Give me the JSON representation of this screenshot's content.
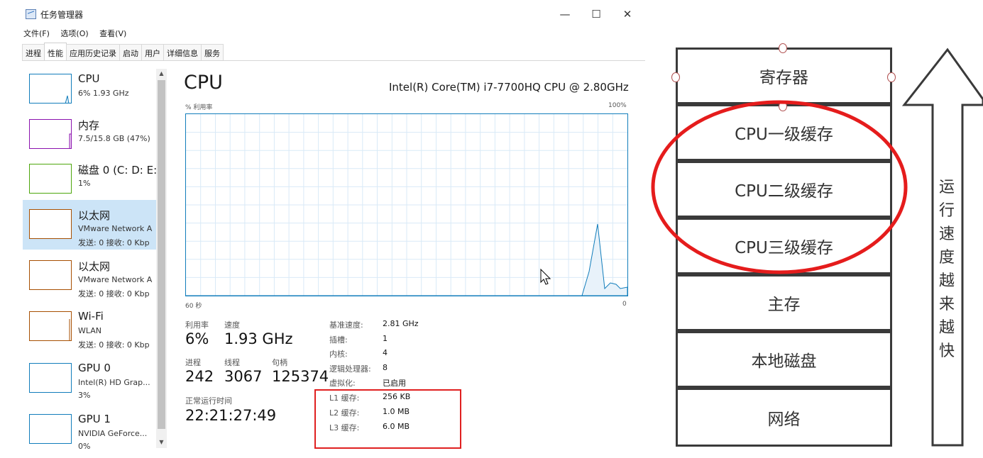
{
  "window": {
    "title": "任务管理器",
    "menu": [
      "文件(F)",
      "选项(O)",
      "查看(V)"
    ],
    "tabs": [
      "进程",
      "性能",
      "应用历史记录",
      "启动",
      "用户",
      "详细信息",
      "服务"
    ],
    "active_tab": "性能"
  },
  "sidebar": {
    "items": [
      {
        "name": "CPU",
        "sub": "6% 1.93 GHz",
        "sub2": "",
        "color": "#117dbb"
      },
      {
        "name": "内存",
        "sub": "7.5/15.8 GB (47%)",
        "sub2": "",
        "color": "#8b12ae"
      },
      {
        "name": "磁盘 0 (C: D: E:",
        "sub": "1%",
        "sub2": "",
        "color": "#4da60c"
      },
      {
        "name": "以太网",
        "sub": "VMware Network A",
        "sub2": "发送: 0 接收: 0 Kbp",
        "color": "#a74f01"
      },
      {
        "name": "以太网",
        "sub": "VMware Network A",
        "sub2": "发送: 0 接收: 0 Kbp",
        "color": "#a74f01"
      },
      {
        "name": "Wi-Fi",
        "sub": "WLAN",
        "sub2": "发送: 0 接收: 0 Kbp",
        "color": "#a74f01"
      },
      {
        "name": "GPU 0",
        "sub": "Intel(R) HD Grap...",
        "sub2": "3%",
        "color": "#117dbb"
      },
      {
        "name": "GPU 1",
        "sub": "NVIDIA GeForce...",
        "sub2": "0%",
        "color": "#117dbb"
      }
    ]
  },
  "main": {
    "title": "CPU",
    "model": "Intel(R) Core(TM) i7-7700HQ CPU @ 2.80GHz",
    "graph_ylabel": "% 利用率",
    "graph_ymax": "100%",
    "graph_xleft": "60 秒",
    "graph_xright": "0",
    "stats": {
      "util_label": "利用率",
      "util_value": "6%",
      "speed_label": "速度",
      "speed_value": "1.93 GHz",
      "proc_label": "进程",
      "proc_value": "242",
      "thread_label": "线程",
      "thread_value": "3067",
      "handle_label": "句柄",
      "handle_value": "125374",
      "uptime_label": "正常运行时间",
      "uptime_value": "22:21:27:49"
    },
    "details": [
      {
        "k": "基准速度:",
        "v": "2.81 GHz"
      },
      {
        "k": "插槽:",
        "v": "1"
      },
      {
        "k": "内核:",
        "v": "4"
      },
      {
        "k": "逻辑处理器:",
        "v": "8"
      },
      {
        "k": "虚拟化:",
        "v": "已启用"
      },
      {
        "k": "L1 缓存:",
        "v": "256 KB"
      },
      {
        "k": "L2 缓存:",
        "v": "1.0 MB"
      },
      {
        "k": "L3 缓存:",
        "v": "6.0 MB"
      }
    ]
  },
  "diagram": {
    "levels": [
      "寄存器",
      "CPU一级缓存",
      "CPU二级缓存",
      "CPU三级缓存",
      "主存",
      "本地磁盘",
      "网络"
    ],
    "arrow_text": [
      "运",
      "行",
      "速",
      "度",
      "越",
      "来",
      "越",
      "快"
    ]
  },
  "colors": {
    "cpu_blue": "#117dbb",
    "highlight_red": "#e02020",
    "select_bg": "#cce4f7"
  }
}
